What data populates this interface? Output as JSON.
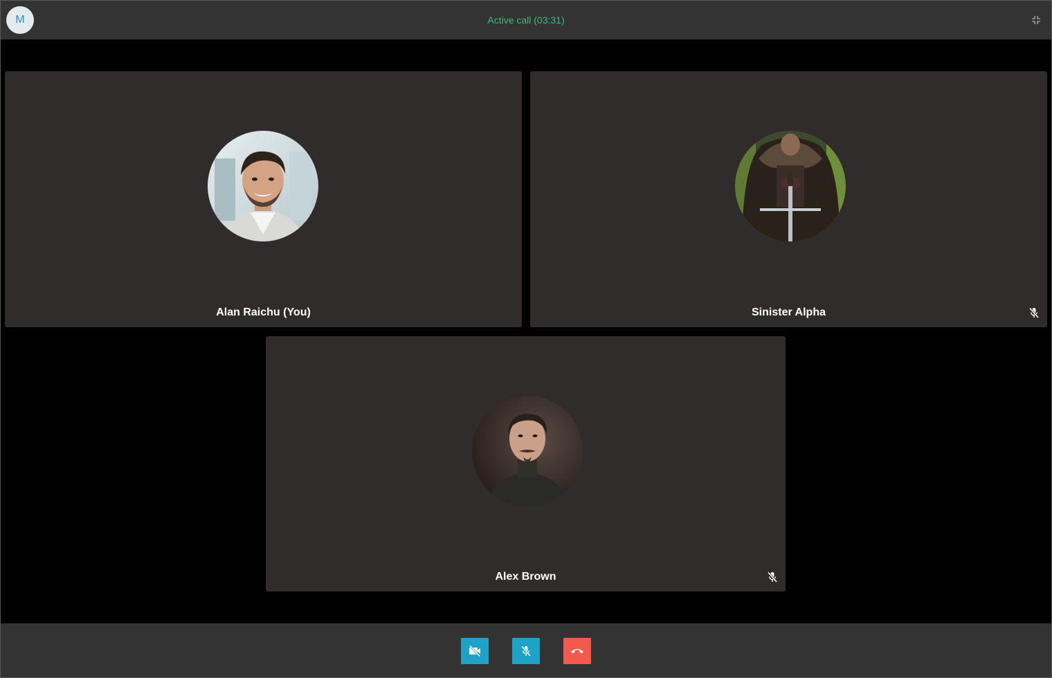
{
  "header": {
    "user_initial": "M",
    "call_status": "Active call (03:31)"
  },
  "participants": [
    {
      "name": "Alan Raichu (You)",
      "muted": false
    },
    {
      "name": "Sinister Alpha",
      "muted": true
    },
    {
      "name": "Alex Brown",
      "muted": true
    }
  ],
  "controls": {
    "video_icon": "video-off-icon",
    "mic_icon": "mic-off-icon",
    "hangup_icon": "phone-hangup-icon"
  },
  "colors": {
    "accent_green": "#3dbb7a",
    "control_blue": "#1ea2c6",
    "hangup_red": "#f25a4d",
    "tile_bg": "#312c2c",
    "bar_bg": "#333333"
  }
}
